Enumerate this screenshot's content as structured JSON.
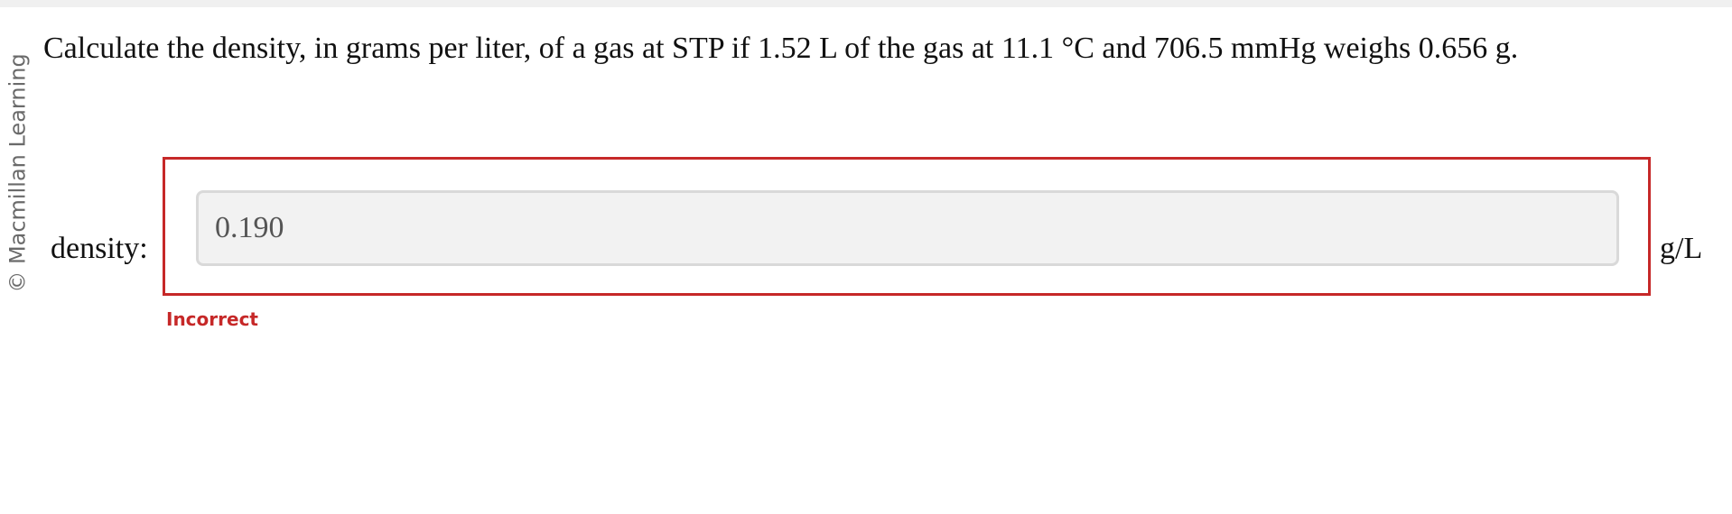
{
  "watermark": "© Macmillan Learning",
  "question": "Calculate the density, in grams per liter, of a gas at STP if 1.52 L of the gas at 11.1 °C and 706.5 mmHg weighs 0.656 g.",
  "answer": {
    "label": "density:",
    "value": "0.190",
    "unit": "g/L",
    "feedback": "Incorrect"
  },
  "colors": {
    "error": "#c62828",
    "input_bg": "#f2f2f2"
  }
}
